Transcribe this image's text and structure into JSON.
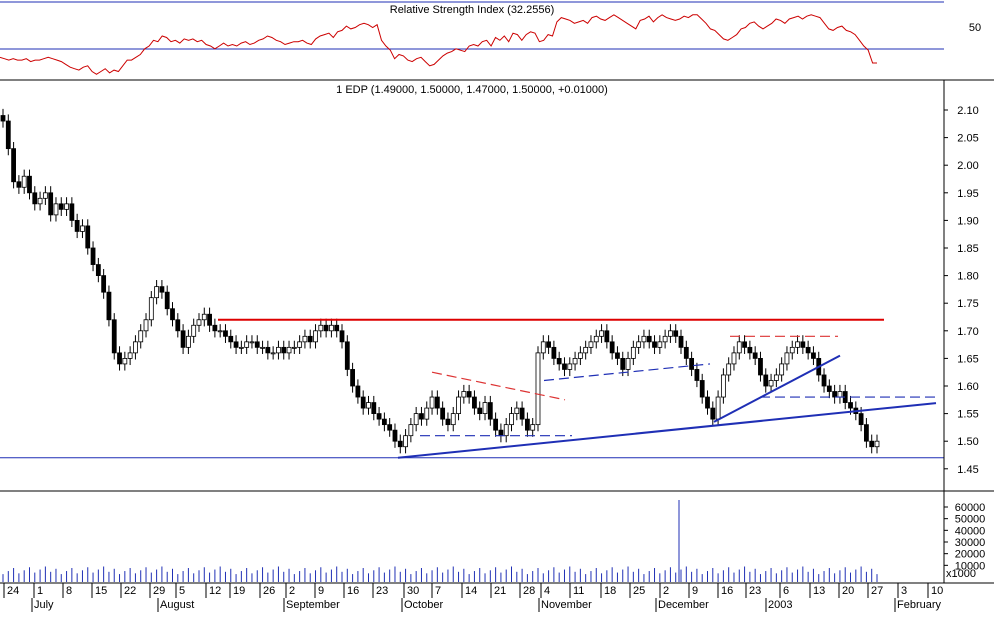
{
  "chart_data": [
    {
      "type": "line",
      "title": "Relative Strength Index (32.2556)",
      "yticks": [
        50
      ],
      "ylim": [
        20,
        75
      ],
      "reference_line": 32,
      "series": [
        {
          "color": "#cc0000",
          "values": [
            36,
            35,
            34,
            35,
            34,
            34,
            35,
            33,
            34,
            34,
            35,
            36,
            35,
            34,
            33,
            31,
            29,
            28,
            27,
            29,
            30,
            26,
            24,
            26,
            28,
            25,
            27,
            26,
            30,
            34,
            34,
            36,
            38,
            42,
            44,
            48,
            47,
            51,
            50,
            47,
            48,
            46,
            49,
            48,
            49,
            47,
            48,
            45,
            44,
            42,
            44,
            46,
            44,
            45,
            44,
            46,
            47,
            45,
            46,
            48,
            49,
            51,
            50,
            48,
            47,
            45,
            46,
            47,
            47,
            48,
            46,
            45,
            49,
            51,
            52,
            53,
            50,
            54,
            55,
            58,
            56,
            57,
            59,
            60,
            59,
            57,
            59,
            48,
            44,
            41,
            35,
            38,
            37,
            34,
            33,
            35,
            36,
            33,
            30,
            31,
            34,
            37,
            39,
            40,
            42,
            41,
            40,
            44,
            45,
            44,
            47,
            48,
            44,
            50,
            48,
            51,
            47,
            53,
            52,
            48,
            52,
            54,
            53,
            47,
            48,
            52,
            51,
            61,
            64,
            63,
            62,
            60,
            61,
            62,
            60,
            64,
            65,
            63,
            62,
            64,
            66,
            64,
            62,
            60,
            58,
            56,
            62,
            63,
            65,
            61,
            64,
            66,
            64,
            63,
            62,
            63,
            65,
            64,
            66,
            66,
            63,
            60,
            56,
            55,
            52,
            49,
            48,
            50,
            52,
            56,
            57,
            60,
            61,
            58,
            56,
            58,
            60,
            63,
            62,
            60,
            63,
            64,
            65,
            63,
            65,
            66,
            65,
            64,
            60,
            56,
            55,
            57,
            58,
            55,
            54,
            52,
            48,
            44,
            41,
            32,
            32
          ],
          "x_start": 0,
          "x_end": 877
        }
      ]
    },
    {
      "type": "candlestick",
      "title": "1 EDP (1.49000, 1.50000, 1.47000, 1.50000, +0.01000)",
      "ylim": [
        1.41,
        2.14
      ],
      "yticks": [
        "2.10",
        "2.05",
        "2.00",
        "1.95",
        "1.90",
        "1.85",
        "1.80",
        "1.75",
        "1.70",
        "1.65",
        "1.60",
        "1.55",
        "1.50",
        "1.45"
      ],
      "close_values": [
        2.08,
        2.03,
        1.97,
        1.96,
        1.98,
        1.95,
        1.93,
        1.94,
        1.95,
        1.91,
        1.93,
        1.92,
        1.93,
        1.9,
        1.88,
        1.89,
        1.85,
        1.82,
        1.8,
        1.77,
        1.72,
        1.66,
        1.64,
        1.65,
        1.66,
        1.68,
        1.7,
        1.72,
        1.76,
        1.78,
        1.77,
        1.74,
        1.72,
        1.7,
        1.67,
        1.69,
        1.71,
        1.72,
        1.73,
        1.71,
        1.7,
        1.7,
        1.69,
        1.68,
        1.67,
        1.67,
        1.68,
        1.68,
        1.67,
        1.67,
        1.66,
        1.66,
        1.67,
        1.66,
        1.67,
        1.67,
        1.68,
        1.69,
        1.68,
        1.7,
        1.71,
        1.7,
        1.71,
        1.7,
        1.68,
        1.63,
        1.6,
        1.58,
        1.56,
        1.57,
        1.55,
        1.54,
        1.53,
        1.52,
        1.5,
        1.49,
        1.51,
        1.53,
        1.55,
        1.54,
        1.56,
        1.58,
        1.56,
        1.54,
        1.53,
        1.55,
        1.58,
        1.59,
        1.58,
        1.56,
        1.55,
        1.57,
        1.54,
        1.52,
        1.51,
        1.53,
        1.55,
        1.56,
        1.54,
        1.52,
        1.53,
        1.66,
        1.68,
        1.67,
        1.65,
        1.64,
        1.63,
        1.64,
        1.65,
        1.66,
        1.67,
        1.68,
        1.69,
        1.7,
        1.68,
        1.66,
        1.65,
        1.63,
        1.65,
        1.67,
        1.68,
        1.69,
        1.68,
        1.67,
        1.68,
        1.69,
        1.7,
        1.69,
        1.67,
        1.65,
        1.63,
        1.61,
        1.58,
        1.56,
        1.54,
        1.58,
        1.62,
        1.64,
        1.66,
        1.68,
        1.67,
        1.66,
        1.65,
        1.62,
        1.6,
        1.61,
        1.62,
        1.64,
        1.66,
        1.67,
        1.68,
        1.67,
        1.66,
        1.65,
        1.62,
        1.6,
        1.59,
        1.58,
        1.59,
        1.57,
        1.56,
        1.55,
        1.53,
        1.5,
        1.49,
        1.5
      ],
      "x_start": 3,
      "x_end": 877,
      "lines": [
        {
          "color": "#dd0000",
          "style": "solid",
          "from": [
            218,
            1.72
          ],
          "to": [
            884,
            1.72
          ]
        },
        {
          "color": "#1f2fb5",
          "style": "solid",
          "from": [
            398,
            1.47
          ],
          "to": [
            936,
            1.569
          ]
        },
        {
          "color": "#dd3333",
          "style": "dashed",
          "from": [
            432,
            1.625
          ],
          "to": [
            565,
            1.575
          ]
        },
        {
          "color": "#dd3333",
          "style": "dashed",
          "from": [
            730,
            1.69
          ],
          "to": [
            838,
            1.69
          ]
        },
        {
          "color": "#1f2fb5",
          "style": "dashed",
          "from": [
            420,
            1.51
          ],
          "to": [
            572,
            1.51
          ]
        },
        {
          "color": "#1f2fb5",
          "style": "dashed",
          "from": [
            544,
            1.61
          ],
          "to": [
            710,
            1.64
          ]
        },
        {
          "color": "#1f2fb5",
          "style": "dashed",
          "from": [
            760,
            1.58
          ],
          "to": [
            936,
            1.58
          ]
        },
        {
          "color": "#1f2fb5",
          "style": "solid",
          "from": [
            714,
            1.535
          ],
          "to": [
            840,
            1.655
          ]
        }
      ],
      "support_line": 1.47
    },
    {
      "type": "bar",
      "title": "",
      "unit_label": "x1000",
      "ylim": [
        0,
        67000
      ],
      "yticks": [
        "60000",
        "50000",
        "40000",
        "30000",
        "20000",
        "10000"
      ],
      "spike": {
        "x": 679,
        "value": 66000
      },
      "x_start": 3,
      "x_end": 877
    }
  ],
  "x_axis": {
    "day_ticks": [
      "24",
      "1",
      "8",
      "15",
      "22",
      "29",
      "5",
      "12",
      "19",
      "26",
      "2",
      "9",
      "16",
      "23",
      "30",
      "7",
      "14",
      "21",
      "28",
      "4",
      "11",
      "18",
      "25",
      "2",
      "9",
      "16",
      "23",
      "6",
      "13",
      "20",
      "27",
      "3",
      "10"
    ],
    "month_labels": [
      "July",
      "August",
      "September",
      "October",
      "November",
      "December",
      "2003",
      "February"
    ]
  },
  "colors": {
    "bar": "#1f2fb5",
    "price_line": "#1f2fb5",
    "resistance": "#dd0000",
    "rsi": "#cc0000",
    "candle": "#000000"
  }
}
